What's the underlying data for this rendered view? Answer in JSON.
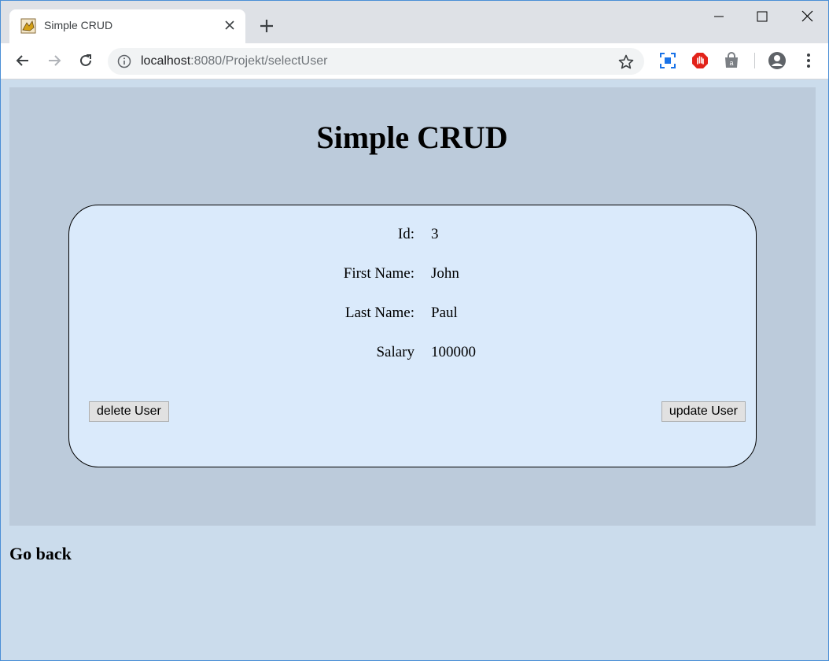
{
  "browser": {
    "tab_title": "Simple CRUD",
    "url_host": "localhost",
    "url_rest": ":8080/Projekt/selectUser"
  },
  "page": {
    "title": "Simple CRUD",
    "fields": [
      {
        "label": "Id:",
        "value": "3"
      },
      {
        "label": "First Name:",
        "value": "John"
      },
      {
        "label": "Last Name:",
        "value": "Paul"
      },
      {
        "label": "Salary",
        "value": "100000"
      }
    ],
    "delete_button": "delete User",
    "update_button": "update User",
    "go_back": "Go back"
  }
}
